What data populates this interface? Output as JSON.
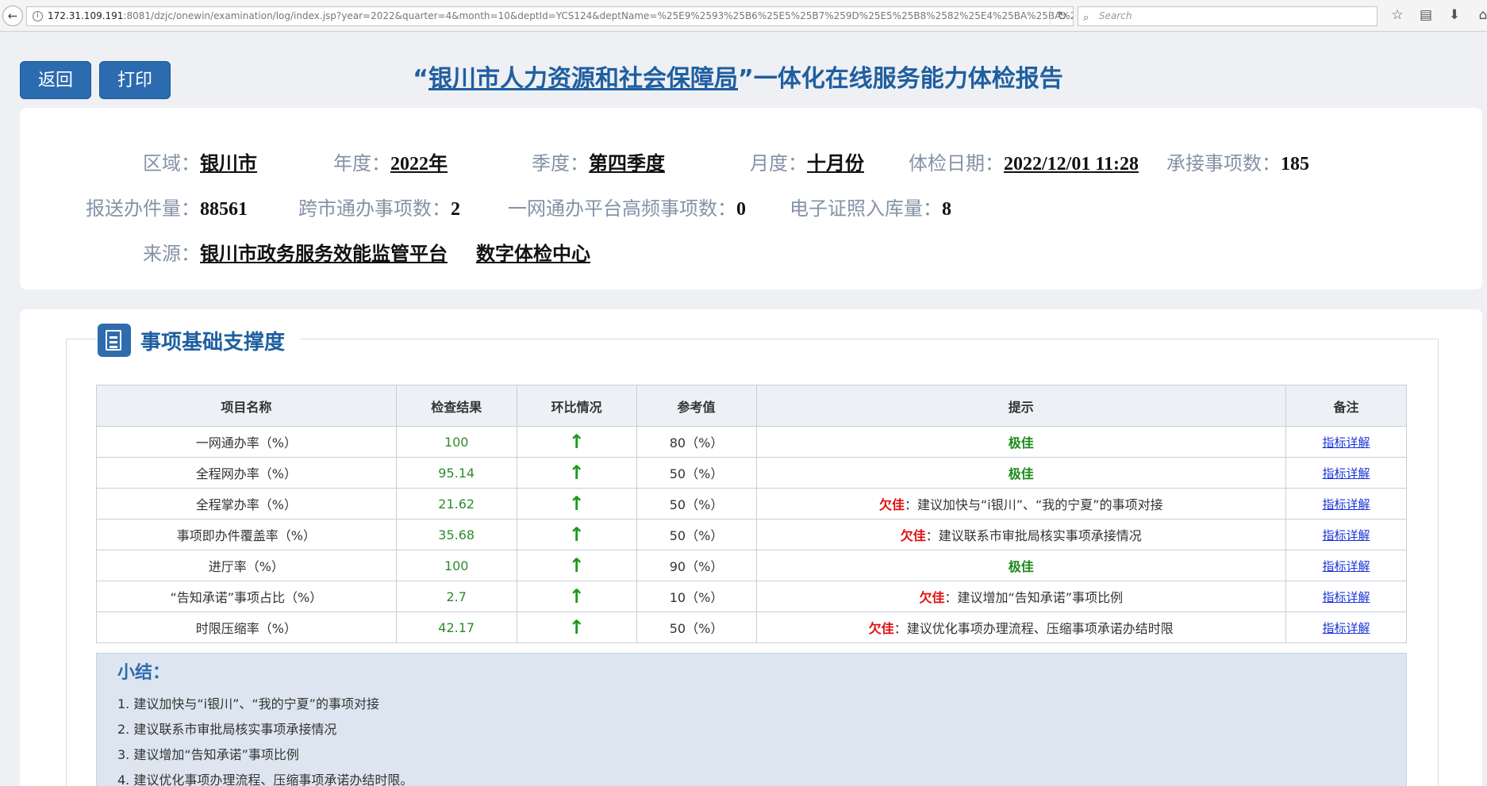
{
  "browser": {
    "url_host": "172.31.109.191",
    "url_rest": ":8081/dzjc/onewin/examination/log/index.jsp?year=2022&quarter=4&month=10&deptId=YCS124&deptName=%25E9%2593%25B6%25E5%25B7%259D%25E5%25B8%2582%25E4%25BA%25BA%2",
    "search_placeholder": "Search"
  },
  "header": {
    "back_label": "返回",
    "print_label": "打印",
    "title_open_quote": "“",
    "title_dept": "银川市人力资源和社会保障局",
    "title_close": "”一体化在线服务能力体检报告"
  },
  "info": {
    "region_label": "区域：",
    "region_value": "银川市",
    "year_label": "年度：",
    "year_value": "2022年",
    "quarter_label": "季度：",
    "quarter_value": "第四季度",
    "month_label": "月度：",
    "month_value": "十月份",
    "date_label": "体检日期：",
    "date_value": "2022/12/01 11:28",
    "items_label": "承接事项数：",
    "items_value": "185",
    "volume_label": "报送办件量：",
    "volume_value": "88561",
    "cross_label": "跨市通办事项数：",
    "cross_value": "2",
    "freq_label": "一网通办平台高频事项数：",
    "freq_value": "0",
    "cert_label": "电子证照入库量：",
    "cert_value": "8",
    "source_label": "来源：",
    "source_value1": "银川市政务服务效能监管平台",
    "source_value2": "数字体检中心"
  },
  "section": {
    "title": "事项基础支撑度",
    "columns": [
      "项目名称",
      "检查结果",
      "环比情况",
      "参考值",
      "提示",
      "备注"
    ],
    "rows": [
      {
        "name": "一网通办率（%）",
        "result": "100",
        "trend": "↑",
        "ref": "80（%）",
        "tip_level": "极佳",
        "tip_text": "",
        "note": "指标详解"
      },
      {
        "name": "全程网办率（%）",
        "result": "95.14",
        "trend": "↑",
        "ref": "50（%）",
        "tip_level": "极佳",
        "tip_text": "",
        "note": "指标详解"
      },
      {
        "name": "全程掌办率（%）",
        "result": "21.62",
        "trend": "↑",
        "ref": "50（%）",
        "tip_level": "欠佳",
        "tip_text": "：建议加快与“i银川”、“我的宁夏”的事项对接",
        "note": "指标详解"
      },
      {
        "name": "事项即办件覆盖率（%）",
        "result": "35.68",
        "trend": "↑",
        "ref": "50（%）",
        "tip_level": "欠佳",
        "tip_text": "：建议联系市审批局核实事项承接情况",
        "note": "指标详解"
      },
      {
        "name": "进厅率（%）",
        "result": "100",
        "trend": "↑",
        "ref": "90（%）",
        "tip_level": "极佳",
        "tip_text": "",
        "note": "指标详解"
      },
      {
        "name": "“告知承诺”事项占比（%）",
        "result": "2.7",
        "trend": "↑",
        "ref": "10（%）",
        "tip_level": "欠佳",
        "tip_text": "：建议增加“告知承诺”事项比例",
        "note": "指标详解"
      },
      {
        "name": "时限压缩率（%）",
        "result": "42.17",
        "trend": "↑",
        "ref": "50（%）",
        "tip_level": "欠佳",
        "tip_text": "：建议优化事项办理流程、压缩事项承诺办结时限",
        "note": "指标详解"
      }
    ],
    "summary_title": "小结：",
    "summary_items": [
      "1. 建议加快与“i银川”、“我的宁夏”的事项对接",
      "2. 建议联系市审批局核实事项承接情况",
      "3. 建议增加“告知承诺”事项比例",
      "4. 建议优化事项办理流程、压缩事项承诺办结时限。"
    ]
  },
  "colors": {
    "primary": "#2b6bb0",
    "good": "#1b8a1b",
    "bad": "#e01010",
    "link": "#1a34d6"
  }
}
